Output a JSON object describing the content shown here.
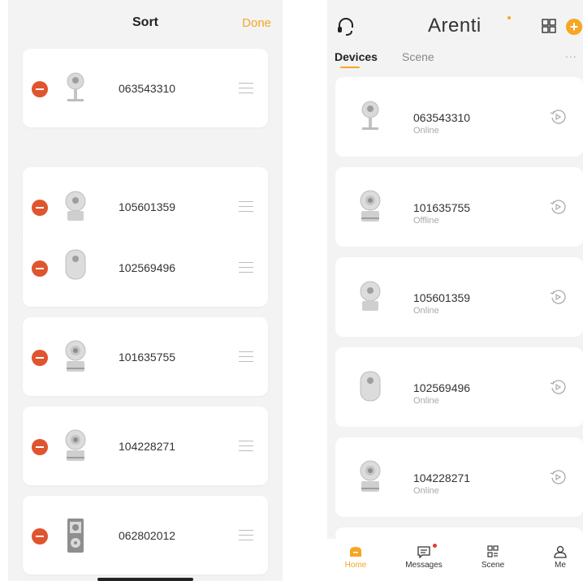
{
  "sort_screen": {
    "title": "Sort",
    "done_label": "Done",
    "devices": [
      {
        "name": "063543310",
        "icon": "cube-camera-icon"
      },
      {
        "name": "105601359",
        "icon": "dome-camera-icon"
      },
      {
        "name": "102569496",
        "icon": "pod-camera-icon"
      },
      {
        "name": "101635755",
        "icon": "pan-tilt-camera-icon"
      },
      {
        "name": "104228271",
        "icon": "pan-tilt-camera-icon"
      },
      {
        "name": "062802012",
        "icon": "doorbell-icon"
      }
    ]
  },
  "home_screen": {
    "brand": "Arenti",
    "tabs": [
      {
        "label": "Devices",
        "active": true
      },
      {
        "label": "Scene",
        "active": false
      }
    ],
    "more_label": "...",
    "devices": [
      {
        "name": "063543310",
        "status": "Online",
        "icon": "cube-camera-icon"
      },
      {
        "name": "101635755",
        "status": "Offline",
        "icon": "pan-tilt-camera-icon"
      },
      {
        "name": "105601359",
        "status": "Online",
        "icon": "dome-camera-icon"
      },
      {
        "name": "102569496",
        "status": "Online",
        "icon": "pod-camera-icon"
      },
      {
        "name": "104228271",
        "status": "Online",
        "icon": "pan-tilt-camera-icon"
      }
    ],
    "nav": [
      {
        "label": "Home",
        "icon": "home-icon",
        "active": true
      },
      {
        "label": "Messages",
        "icon": "messages-icon",
        "active": false
      },
      {
        "label": "Scene",
        "icon": "scene-icon",
        "active": false
      },
      {
        "label": "Me",
        "icon": "profile-icon",
        "active": false
      }
    ]
  },
  "colors": {
    "accent": "#f5a623",
    "remove": "#e0542e",
    "background": "#f3f3f3",
    "card": "#ffffff",
    "notification": "#e53935"
  }
}
